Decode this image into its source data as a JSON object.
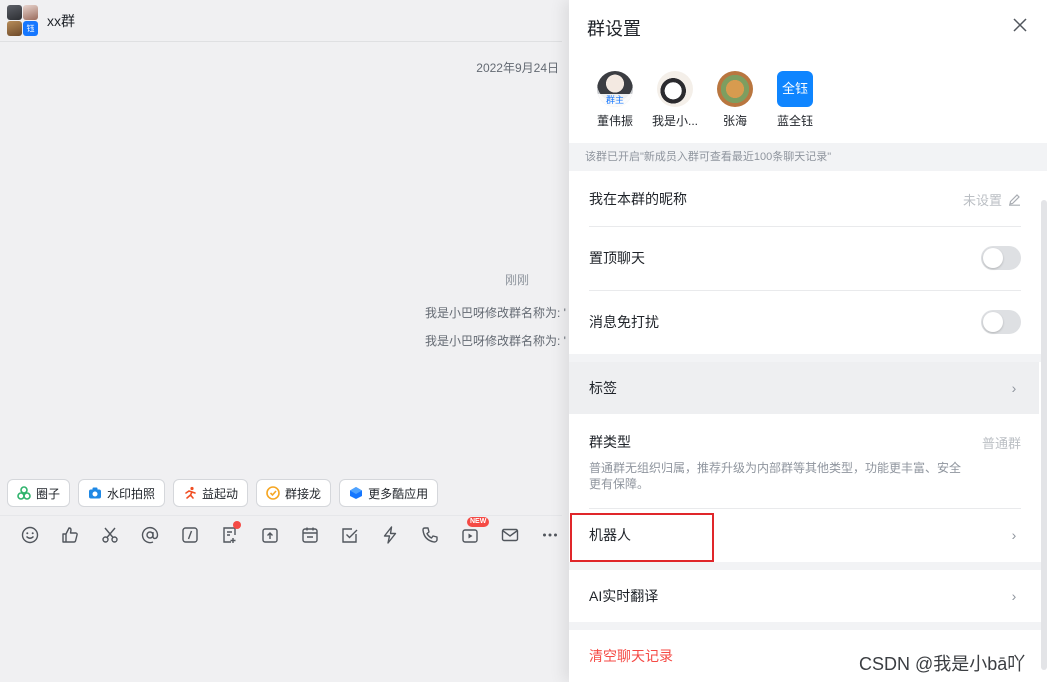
{
  "chat": {
    "title": "xx群",
    "group_avatar_badge": "钰",
    "date_stamp": "2022年9月24日",
    "just_now": "刚刚",
    "messages": [
      "我是小巴呀修改群名称为: '",
      "我是小巴呀修改群名称为: '"
    ],
    "apps": [
      {
        "label": "圈子",
        "icon": "circle-app-icon",
        "color": "#2fb36c"
      },
      {
        "label": "水印拍照",
        "icon": "camera-icon",
        "color": "#1e88e5"
      },
      {
        "label": "益起动",
        "icon": "runner-icon",
        "color": "#f04e23"
      },
      {
        "label": "群接龙",
        "icon": "relay-icon",
        "color": "#f5a623"
      },
      {
        "label": "更多酷应用",
        "icon": "more-apps-icon",
        "color": "#1677ff"
      }
    ],
    "toolbar_icons": [
      "emoji-icon",
      "thumbs-up-icon",
      "scissors-icon",
      "at-icon",
      "slash-command-icon",
      "note-icon",
      "upload-icon",
      "calendar-icon",
      "task-icon",
      "lightning-icon",
      "phone-icon",
      "live-icon",
      "mail-icon",
      "more-icon"
    ],
    "new_badge": "NEW"
  },
  "panel": {
    "title": "群设置",
    "members": [
      {
        "name": "董伟振",
        "tag": "群主"
      },
      {
        "name": "我是小..."
      },
      {
        "name": "张海"
      },
      {
        "name": "蓝全钰",
        "avatar_text": "全钰"
      }
    ],
    "notice": "该群已开启\"新成员入群可查看最近100条聊天记录\"",
    "nickname": {
      "label": "我在本群的昵称",
      "value": "未设置"
    },
    "pin_chat": {
      "label": "置顶聊天",
      "on": false
    },
    "mute": {
      "label": "消息免打扰",
      "on": false
    },
    "tags": {
      "label": "标签"
    },
    "group_type": {
      "label": "群类型",
      "value": "普通群",
      "desc": "普通群无组织归属，推荐升级为内部群等其他类型，功能更丰富、安全更有保障。"
    },
    "robot": {
      "label": "机器人"
    },
    "translate": {
      "label": "AI实时翻译"
    },
    "clear": {
      "label": "清空聊天记录"
    }
  },
  "watermark": "CSDN @我是小bā吖",
  "colors": {
    "accent": "#1677ff",
    "danger": "#f54a45",
    "highlight": "#e0262a"
  }
}
